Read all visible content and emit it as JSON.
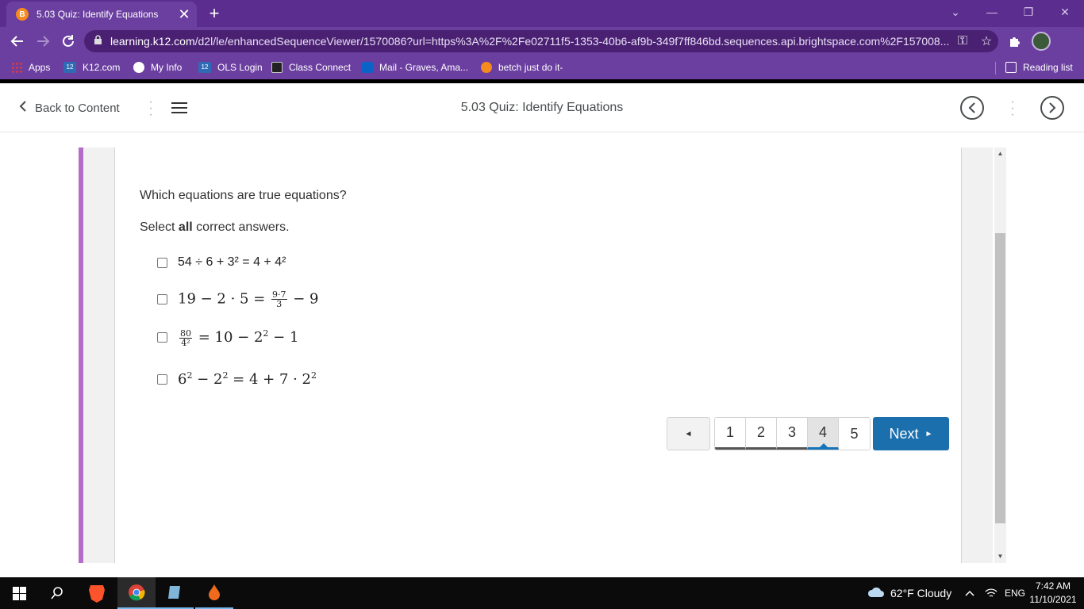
{
  "browser": {
    "tab": {
      "favicon": "B",
      "title": "5.03 Quiz: Identify Equations",
      "close": "✕"
    },
    "new_tab": "+",
    "window_controls": {
      "dropdown": "⌄",
      "minimize": "—",
      "restore": "❐",
      "close": "✕"
    },
    "address": {
      "host": "learning.k12.com",
      "path": "/d2l/le/enhancedSequenceViewer/1570086?url=https%3A%2F%2Fe02711f5-1353-40b6-af9b-349f7ff846bd.sequences.api.brightspace.com%2F157008..."
    },
    "bookmarks": [
      {
        "label": "Apps",
        "icon": "apps-icon"
      },
      {
        "label": "K12.com",
        "icon": "k12-icon"
      },
      {
        "label": "My Info",
        "icon": "globe-icon"
      },
      {
        "label": "OLS Login",
        "icon": "k12-icon"
      },
      {
        "label": "Class Connect",
        "icon": "video-icon"
      },
      {
        "label": "Mail - Graves, Ama...",
        "icon": "outlook-icon"
      },
      {
        "label": "betch just do it-",
        "icon": "brave-icon"
      }
    ],
    "reading_list": "Reading list"
  },
  "d2l": {
    "back_label": "Back to Content",
    "title": "5.03 Quiz: Identify Equations"
  },
  "quiz": {
    "question": "Which equations are true equations?",
    "instruction_prefix": "Select",
    "instruction_bold": "all",
    "instruction_suffix": "correct answers.",
    "options": [
      {
        "text": "54 ÷ 6 + 3² = 4 + 4²"
      },
      {
        "lhs": "19 − 2 · 5 = ",
        "frac_num": "9·7",
        "frac_den": "3",
        "rhs": " − 9"
      },
      {
        "frac_num": "80",
        "frac_den": "4²",
        "rhs": " = 10 − 2",
        "exp": "2",
        "tail": " − 1"
      },
      {
        "a": "6",
        "a_exp": "2",
        "b": " − 2",
        "b_exp": "2",
        "c": " = 4 + 7 · 2",
        "c_exp": "2"
      }
    ],
    "pagination": {
      "prev": "◄",
      "pages": [
        "1",
        "2",
        "3",
        "4",
        "5"
      ],
      "current": "4",
      "next": "Next",
      "next_arrow": "►"
    }
  },
  "taskbar": {
    "weather": "62°F  Cloudy",
    "language": "ENG",
    "time": "7:42 AM",
    "date": "11/10/2021"
  }
}
